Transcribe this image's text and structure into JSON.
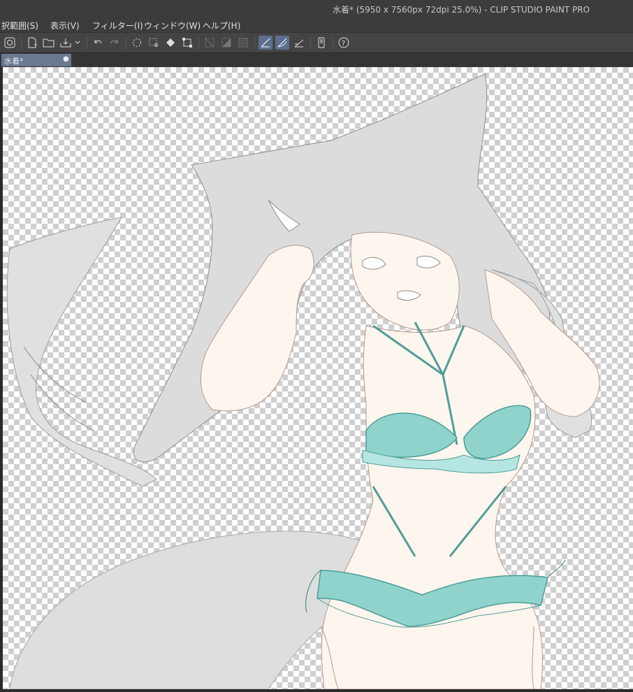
{
  "window": {
    "title": "水着* (5950 x 7560px 72dpi 25.0%)  - CLIP STUDIO PAINT PRO"
  },
  "menu": {
    "items": [
      "択範囲(S)",
      "表示(V)",
      "フィルター(I)",
      "ウィンドウ(W)",
      "ヘルプ(H)"
    ]
  },
  "toolbar": {
    "icons": [
      "clip-studio-logo-icon",
      "new-file-icon",
      "open-file-icon",
      "export-icon",
      "dropdown-chevron-icon",
      "undo-icon",
      "redo-icon",
      "loading-spinner-icon",
      "selection-icon",
      "fill-icon",
      "transform-icon",
      "clear-selection-icon",
      "invert-selection-icon",
      "show-selection-icon",
      "snap-ruler-icon",
      "snap-special-ruler-icon",
      "snap-grid-icon",
      "tablet-icon",
      "help-icon"
    ]
  },
  "tabs": [
    {
      "label": "水着*",
      "modified": "●"
    }
  ],
  "colors": {
    "hair": "#dadada",
    "skin": "#fdf6ef",
    "swimsuit": "#8fd3cc",
    "swimsuit_line": "#4f9d97",
    "active_tab": "#6a7890"
  }
}
